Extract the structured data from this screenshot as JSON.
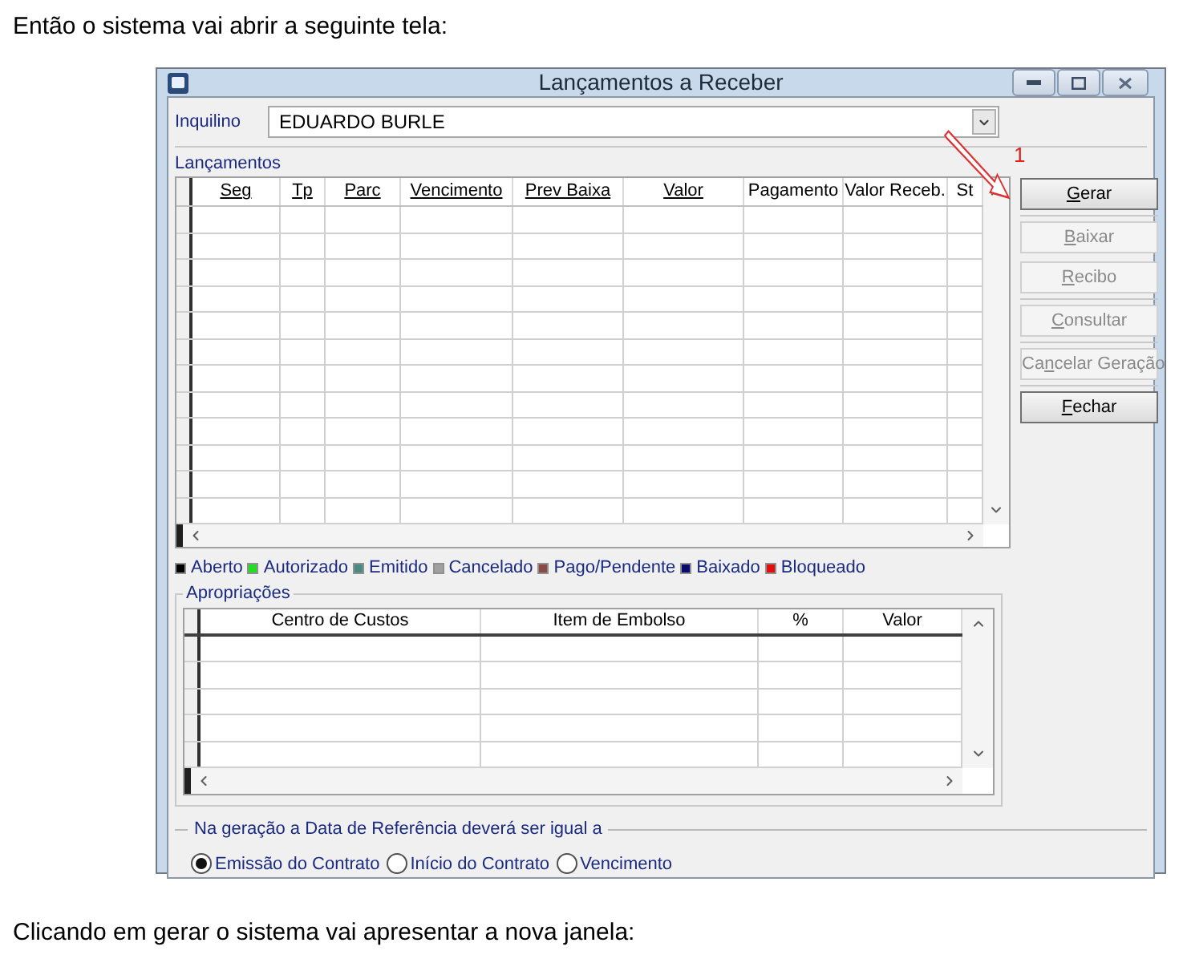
{
  "document": {
    "intro": "Então o sistema vai abrir a seguinte tela:",
    "outro": "Clicando em gerar o sistema vai apresentar a nova janela:"
  },
  "window": {
    "title": "Lançamentos a Receber"
  },
  "tenant": {
    "label": "Inquilino",
    "value": "EDUARDO BURLE"
  },
  "entries": {
    "title": "Lançamentos",
    "columns": [
      {
        "label": "Seg",
        "underlined": true
      },
      {
        "label": "Tp",
        "underlined": true
      },
      {
        "label": "Parc",
        "underlined": true
      },
      {
        "label": "Vencimento",
        "underlined": true
      },
      {
        "label": "Prev Baixa",
        "underlined": true
      },
      {
        "label": "Valor",
        "underlined": true
      },
      {
        "label": "Pagamento",
        "underlined": false
      },
      {
        "label": "Valor Receb.",
        "underlined": false
      },
      {
        "label": "St",
        "underlined": false
      }
    ]
  },
  "buttons": [
    {
      "key": "G",
      "after": "erar",
      "disabled": false
    },
    {
      "key": "B",
      "after": "aixar",
      "disabled": true
    },
    {
      "key": "R",
      "after": "ecibo",
      "disabled": true
    },
    {
      "key": "C",
      "after": "onsultar",
      "disabled": true
    },
    {
      "before": "Ca",
      "key": "n",
      "after": "celar Geração",
      "disabled": true
    },
    {
      "key": "F",
      "after": "echar",
      "disabled": false
    }
  ],
  "annotation": {
    "label": "1"
  },
  "legend": [
    {
      "label": "Aberto",
      "color": "#000000"
    },
    {
      "label": "Autorizado",
      "color": "#22dd22"
    },
    {
      "label": "Emitido",
      "color": "#4a8a80"
    },
    {
      "label": "Cancelado",
      "color": "#a0a0a0"
    },
    {
      "label": "Pago/Pendente",
      "color": "#8b4a45"
    },
    {
      "label": "Baixado",
      "color": "#0a0a6a"
    },
    {
      "label": "Bloqueado",
      "color": "#e01010"
    }
  ],
  "appropriations": {
    "title": "Apropriações",
    "columns": [
      "Centro de Custos",
      "Item de Embolso",
      "%",
      "Valor"
    ]
  },
  "reference_date": {
    "title": "Na geração a Data de Referência deverá ser igual a",
    "options": [
      {
        "label": "Emissão do Contrato",
        "selected": true
      },
      {
        "label": "Início do Contrato",
        "selected": false
      },
      {
        "label": "Vencimento",
        "selected": false
      }
    ]
  }
}
